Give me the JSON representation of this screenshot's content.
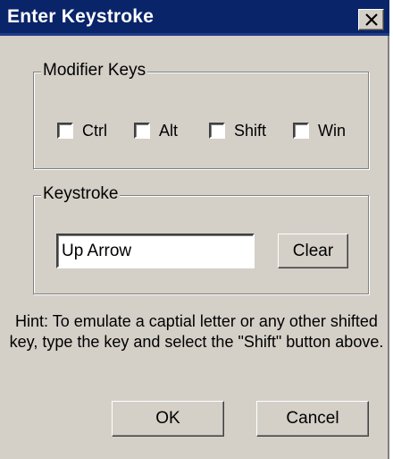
{
  "window": {
    "title": "Enter Keystroke",
    "close_icon": "close-icon"
  },
  "modifier_group": {
    "label": "Modifier Keys",
    "checkboxes": [
      {
        "label": "Ctrl",
        "checked": false
      },
      {
        "label": "Alt",
        "checked": false
      },
      {
        "label": "Shift",
        "checked": false
      },
      {
        "label": "Win",
        "checked": false
      }
    ]
  },
  "keystroke_group": {
    "label": "Keystroke",
    "value": "Up Arrow",
    "clear_label": "Clear"
  },
  "hint": {
    "text": "Hint: To emulate a captial letter or any other shifted key, type the key and select the \"Shift\" button above."
  },
  "buttons": {
    "ok_label": "OK",
    "cancel_label": "Cancel"
  },
  "colors": {
    "titlebar": "#0a246a",
    "dialog_face": "#d4d0c8"
  }
}
